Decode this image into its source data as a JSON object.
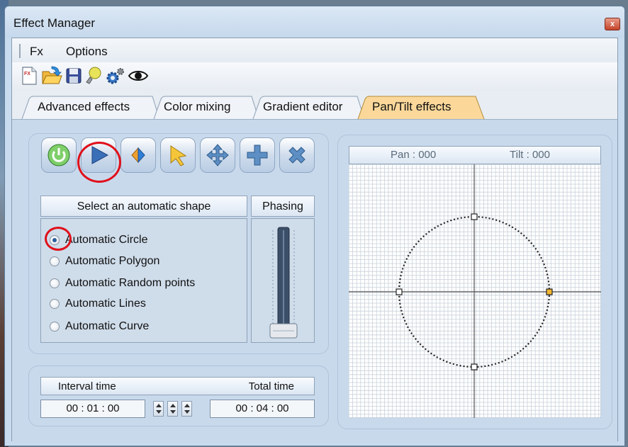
{
  "window": {
    "title": "Effect Manager",
    "close_label": "x"
  },
  "menu": {
    "items": [
      "Fx",
      "Options"
    ]
  },
  "toolbar": {
    "icons": [
      "new-effect-icon",
      "open-folder-icon",
      "save-icon",
      "lightbulb-icon",
      "settings-gears-icon",
      "preview-eye-icon"
    ]
  },
  "tabs": [
    {
      "label": "Advanced effects",
      "active": false
    },
    {
      "label": "Color mixing",
      "active": false
    },
    {
      "label": "Gradient editor",
      "active": false
    },
    {
      "label": "Pan/Tilt effects",
      "active": true
    }
  ],
  "tools": [
    "power-icon",
    "play-icon",
    "stop-icon",
    "pointer-icon",
    "move-icon",
    "add-icon",
    "delete-icon"
  ],
  "shapes": {
    "header": "Select an automatic shape",
    "options": [
      "Automatic Circle",
      "Automatic Polygon",
      "Automatic Random points",
      "Automatic Lines",
      "Automatic Curve"
    ],
    "selected": "Automatic Circle"
  },
  "phasing": {
    "header": "Phasing",
    "value": 0
  },
  "timing": {
    "interval_label": "Interval time",
    "interval_value": "00 : 01 : 00",
    "total_label": "Total time",
    "total_value": "00 : 04 : 00"
  },
  "pantilt": {
    "pan_label": "Pan : 000",
    "tilt_label": "Tilt : 000"
  },
  "colors": {
    "active_tab": "#fbd89a",
    "annotation": "#e0101a",
    "content_bg": "#c8d9ec"
  }
}
